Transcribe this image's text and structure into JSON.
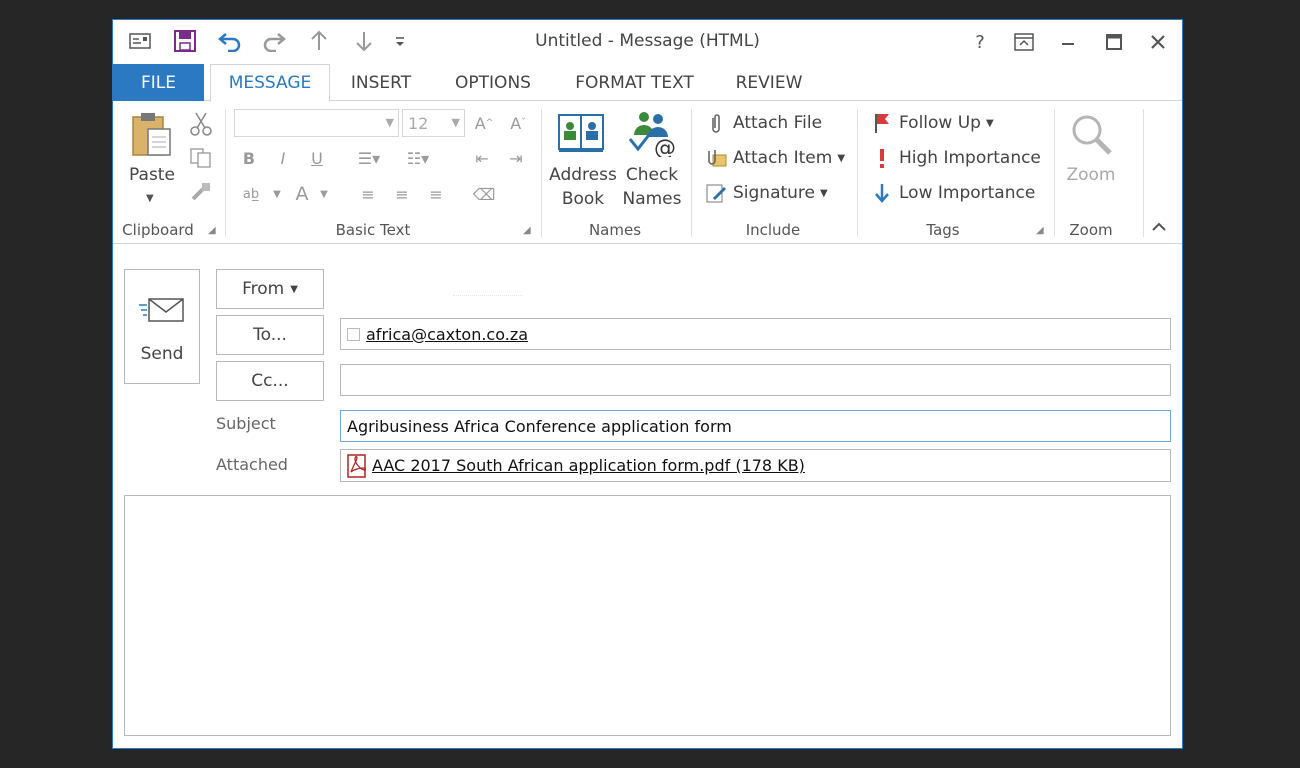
{
  "window": {
    "title": "Untitled - Message (HTML)",
    "help": "?",
    "accent": "#2b79c2"
  },
  "tabs": [
    "FILE",
    "MESSAGE",
    "INSERT",
    "OPTIONS",
    "FORMAT TEXT",
    "REVIEW"
  ],
  "ribbon": {
    "clipboard": {
      "paste": "Paste",
      "label": "Clipboard"
    },
    "basic_text": {
      "font_size": "12",
      "label": "Basic Text"
    },
    "names": {
      "address_book": [
        "Address",
        "Book"
      ],
      "check_names": [
        "Check",
        "Names"
      ],
      "label": "Names"
    },
    "include": {
      "attach_file": "Attach File",
      "attach_item": "Attach Item",
      "signature": "Signature",
      "label": "Include"
    },
    "tags": {
      "follow_up": "Follow Up",
      "high_importance": "High Importance",
      "low_importance": "Low Importance",
      "label": "Tags"
    },
    "zoom": {
      "zoom": "Zoom",
      "label": "Zoom"
    }
  },
  "compose": {
    "send": "Send",
    "from": "From",
    "to": "To...",
    "cc": "Cc...",
    "to_value": "africa@caxton.co.za",
    "cc_value": "",
    "subject_label": "Subject",
    "subject_value": "Agribusiness Africa Conference application form",
    "attached_label": "Attached",
    "attachment": "AAC 2017 South African application form.pdf (178 KB)"
  },
  "icons": {
    "qat": [
      "envelope-icon",
      "save-icon",
      "undo-icon",
      "redo-icon",
      "up-arrow-icon",
      "down-arrow-icon",
      "customize-icon"
    ],
    "flag_color": "#d83b3b",
    "importance_high_color": "#d83b3b",
    "importance_low_color": "#2b79c2"
  }
}
